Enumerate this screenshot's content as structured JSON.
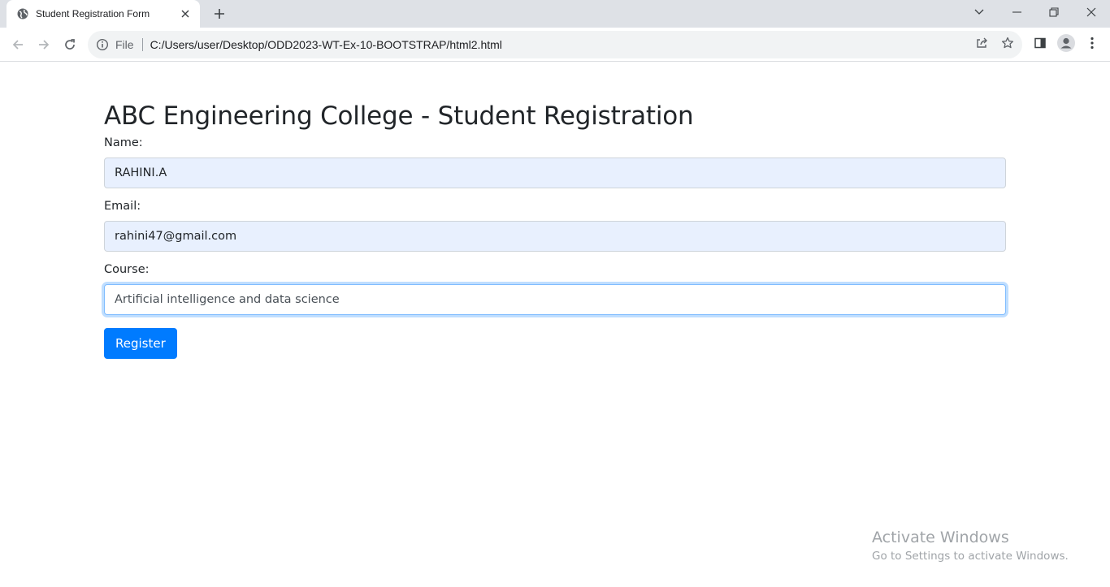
{
  "browser": {
    "tab_title": "Student Registration Form",
    "omnibox": {
      "scheme_label": "File",
      "url": "C:/Users/user/Desktop/ODD2023-WT-Ex-10-BOOTSTRAP/html2.html"
    },
    "icons": {
      "favicon": "globe-icon",
      "close": "close-icon",
      "new_tab": "plus-icon",
      "back": "back-arrow-icon",
      "forward": "forward-arrow-icon",
      "reload": "reload-icon",
      "info": "info-icon",
      "share": "share-icon",
      "bookmark": "star-icon",
      "side_panel": "side-panel-icon",
      "profile": "profile-avatar-icon",
      "menu": "kebab-menu-icon"
    }
  },
  "page": {
    "heading": "ABC Engineering College - Student Registration",
    "form": {
      "name": {
        "label": "Name:",
        "value": "RAHINI.A"
      },
      "email": {
        "label": "Email:",
        "value": "rahini47@gmail.com"
      },
      "course": {
        "label": "Course:",
        "value": "Artificial intelligence and data science"
      },
      "submit_label": "Register"
    },
    "colors": {
      "primary": "#007bff",
      "autofill_bg": "#e8f0fe",
      "focus_border": "#80bdff",
      "text": "#212529"
    }
  },
  "watermark": {
    "title": "Activate Windows",
    "subtitle": "Go to Settings to activate Windows."
  }
}
